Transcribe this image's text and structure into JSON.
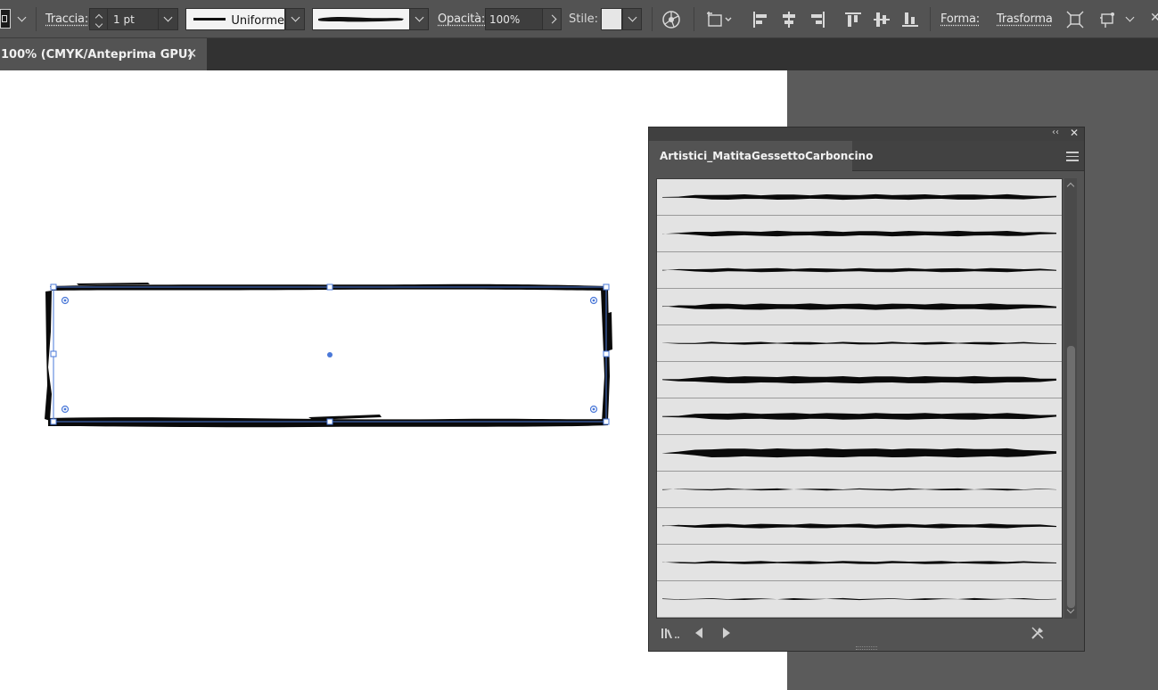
{
  "control_bar": {
    "stroke_label": "Traccia:",
    "stroke_weight": "1 pt",
    "profile_label": "Uniforme",
    "opacity_label": "Opacità:",
    "opacity_value": "100%",
    "style_label": "Stile:",
    "shape_label": "Forma:",
    "transform_label": "Trasforma"
  },
  "document_tab": {
    "title": "100% (CMYK/Anteprima GPU)",
    "close_glyph": "✕"
  },
  "brush_panel": {
    "tab_label": "Artistici_MatitaGessettoCarbonc ino",
    "collapse_glyph": "‹‹",
    "close_glyph": "✕",
    "brush_count": 12
  },
  "colors": {
    "workspace": "#535353",
    "artboard": "#ffffff",
    "selection": "#4a78d8",
    "brush_ink": "#0a0a0a"
  }
}
